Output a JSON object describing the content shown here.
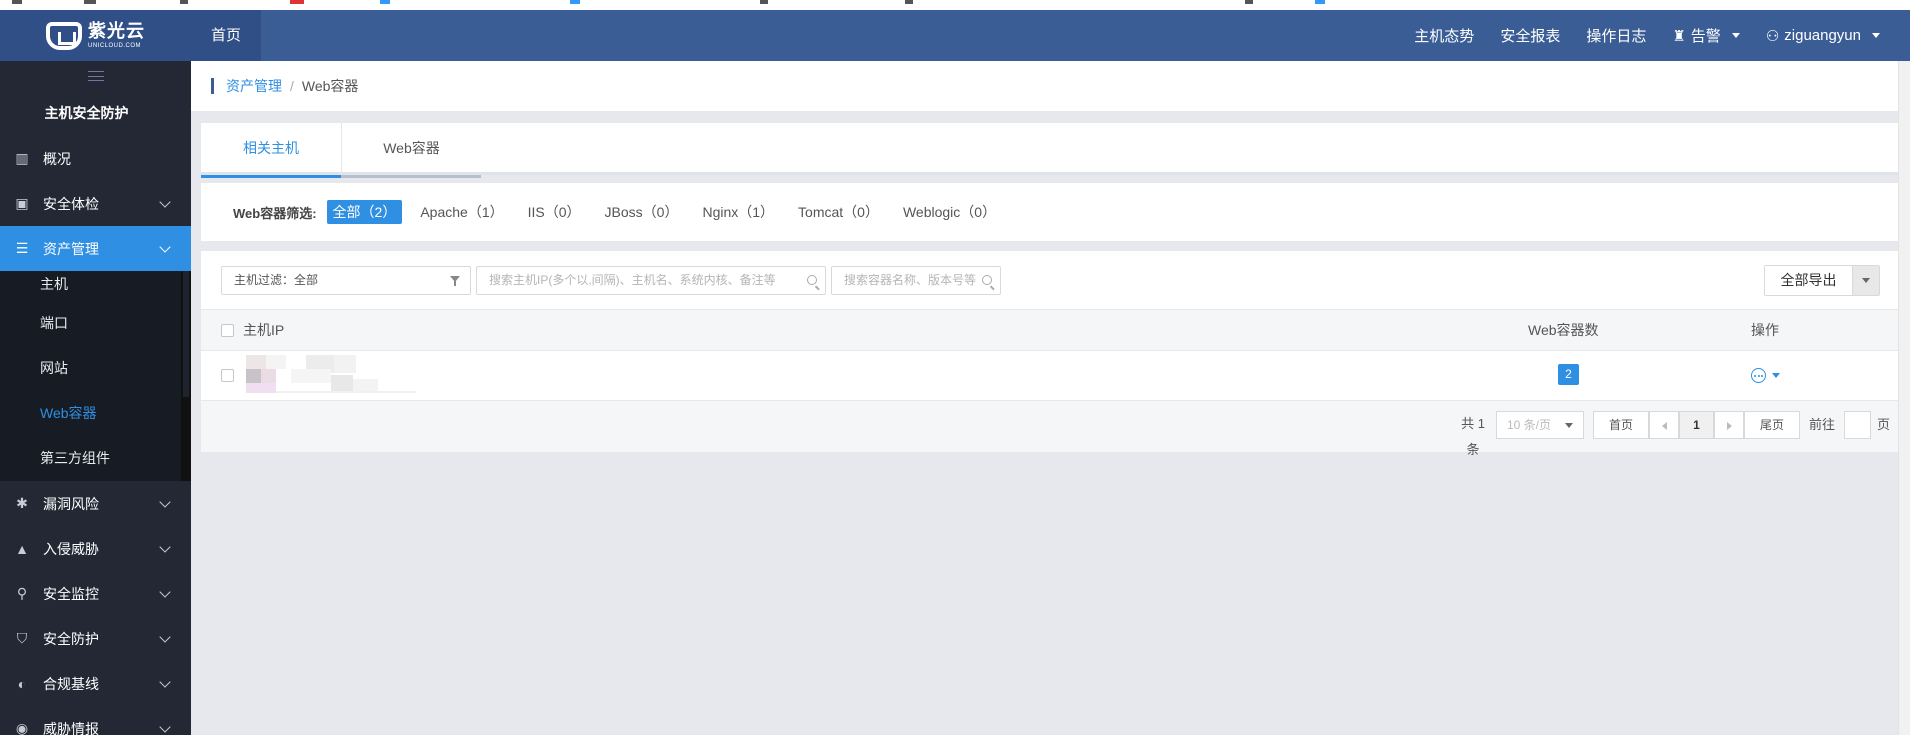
{
  "header": {
    "logo_cn": "紫光云",
    "logo_en": "UNICLOUD.COM",
    "home": "首页",
    "right": [
      "主机态势",
      "安全报表",
      "操作日志"
    ],
    "alarm": "告警",
    "user": "ziguangyun"
  },
  "sidebar": {
    "title": "主机安全防护",
    "items": [
      {
        "label": "概况"
      },
      {
        "label": "安全体检"
      },
      {
        "label": "资产管理"
      },
      {
        "label": "漏洞风险"
      },
      {
        "label": "入侵威胁"
      },
      {
        "label": "安全监控"
      },
      {
        "label": "安全防护"
      },
      {
        "label": "合规基线"
      },
      {
        "label": "威胁情报"
      }
    ],
    "sub_items": [
      "主机",
      "端口",
      "网站",
      "Web容器",
      "第三方组件"
    ]
  },
  "breadcrumb": {
    "parent": "资产管理",
    "sep": "/",
    "current": "Web容器"
  },
  "tabs": [
    "相关主机",
    "Web容器"
  ],
  "filter": {
    "label": "Web容器筛选:",
    "chips": [
      "全部（2）",
      "Apache（1）",
      "IIS（0）",
      "JBoss（0）",
      "Nginx（1）",
      "Tomcat（0）",
      "Weblogic（0）"
    ]
  },
  "toolbar": {
    "host_filter": "主机过滤：全部",
    "search_host_placeholder": "搜索主机IP(多个以,间隔)、主机名、系统内核、备注等",
    "search_container_placeholder": "搜索容器名称、版本号等",
    "export": "全部导出"
  },
  "table": {
    "headers": [
      "主机IP",
      "Web容器数",
      "操作"
    ],
    "rows": [
      {
        "count": "2"
      }
    ]
  },
  "pagination": {
    "total": "共 1 条",
    "page_size": "10 条/页",
    "first": "首页",
    "current": "1",
    "last": "尾页",
    "goto": "前往",
    "unit": "页"
  },
  "colors": {
    "header": "#3a5d96",
    "sidebar": "#232834",
    "accent": "#2f8fe2"
  }
}
